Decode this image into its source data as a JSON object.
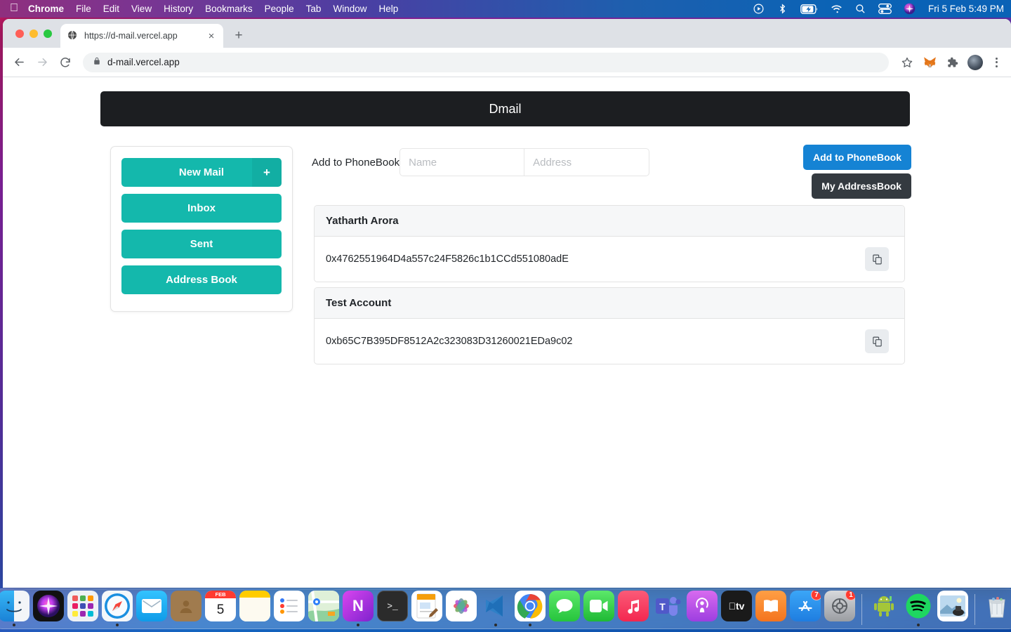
{
  "menubar": {
    "apple_icon": "apple-logo-icon",
    "items": [
      {
        "label": "Chrome",
        "bold": true
      },
      {
        "label": "File",
        "bold": false
      },
      {
        "label": "Edit",
        "bold": false
      },
      {
        "label": "View",
        "bold": false
      },
      {
        "label": "History",
        "bold": false
      },
      {
        "label": "Bookmarks",
        "bold": false
      },
      {
        "label": "People",
        "bold": false
      },
      {
        "label": "Tab",
        "bold": false
      },
      {
        "label": "Window",
        "bold": false
      },
      {
        "label": "Help",
        "bold": false
      }
    ],
    "status_icons": [
      "screen-record-icon",
      "bluetooth-icon",
      "battery-charging-icon",
      "wifi-icon",
      "spotlight-search-icon",
      "control-center-icon",
      "siri-icon"
    ],
    "clock": "Fri 5 Feb  5:49 PM"
  },
  "browser": {
    "tab": {
      "favicon": "globe-icon",
      "title": "https://d-mail.vercel.app",
      "close_label": "×"
    },
    "new_tab_label": "+",
    "toolbar": {
      "back_icon": "arrow-back-icon",
      "forward_icon": "arrow-forward-icon",
      "reload_icon": "reload-icon",
      "lock_icon": "lock-icon",
      "url": "d-mail.vercel.app",
      "bookmark_icon": "star-icon",
      "metamask_icon": "metamask-fox-icon",
      "extensions_icon": "puzzle-piece-icon",
      "profile_icon": "profile-avatar-icon",
      "menu_icon": "three-dot-menu-icon"
    }
  },
  "app": {
    "title": "Dmail",
    "sidebar": {
      "buttons": [
        {
          "label": "New Mail",
          "has_plus": true,
          "plus": "+"
        },
        {
          "label": "Inbox",
          "has_plus": false
        },
        {
          "label": "Sent",
          "has_plus": false
        },
        {
          "label": "Address Book",
          "has_plus": false
        }
      ]
    },
    "add_form": {
      "label": "Add to PhoneBook",
      "name_value": "",
      "name_placeholder": "Name",
      "address_value": "",
      "address_placeholder": "Address"
    },
    "actions": {
      "add_label": "Add to PhoneBook",
      "addressbook_label": "My AddressBook"
    },
    "contacts": [
      {
        "name": "Yatharth Arora",
        "address": "0x4762551964D4a557c24F5826c1b1CCd551080adE",
        "copy_icon": "copy-icon"
      },
      {
        "name": "Test Account",
        "address": "0xb65C7B395DF8512A2c323083D31260021EDa9c02",
        "copy_icon": "copy-icon"
      }
    ],
    "colors": {
      "teal": "#14b8ac",
      "header_dark": "#1c1e21",
      "primary_blue": "#1583d4",
      "dark_button": "#343a40"
    }
  },
  "dock": {
    "items": [
      {
        "name": "finder",
        "running": true
      },
      {
        "name": "siri",
        "running": false
      },
      {
        "name": "launchpad",
        "running": false
      },
      {
        "name": "safari",
        "running": true
      },
      {
        "name": "mail",
        "running": false
      },
      {
        "name": "contacts",
        "running": false
      },
      {
        "name": "calendar",
        "running": false,
        "month": "FEB",
        "day": "5"
      },
      {
        "name": "notes",
        "running": false
      },
      {
        "name": "reminders",
        "running": false
      },
      {
        "name": "maps",
        "running": false
      },
      {
        "name": "notion",
        "running": true
      },
      {
        "name": "terminal",
        "running": false
      },
      {
        "name": "pages",
        "running": false
      },
      {
        "name": "photos",
        "running": false
      },
      {
        "name": "vscode",
        "running": true
      },
      {
        "name": "chrome",
        "running": true
      },
      {
        "name": "messages",
        "running": false
      },
      {
        "name": "facetime",
        "running": false
      },
      {
        "name": "music",
        "running": false
      },
      {
        "name": "teams",
        "running": false
      },
      {
        "name": "podcasts",
        "running": false
      },
      {
        "name": "appletv",
        "running": false
      },
      {
        "name": "books",
        "running": false
      },
      {
        "name": "appstore",
        "running": false,
        "badge": "7"
      },
      {
        "name": "system-preferences",
        "running": false,
        "badge": "1"
      },
      {
        "name": "android-studio",
        "running": false
      },
      {
        "name": "spotify",
        "running": true
      },
      {
        "name": "preview",
        "running": false
      },
      {
        "name": "trash",
        "running": false
      }
    ]
  }
}
